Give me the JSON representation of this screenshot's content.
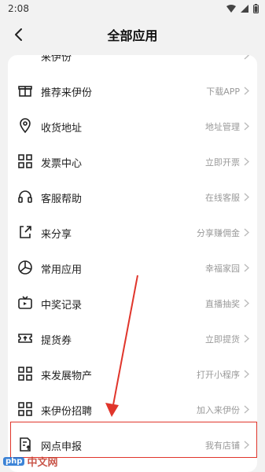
{
  "status": {
    "time": "2:08"
  },
  "header": {
    "title": "全部应用"
  },
  "items": [
    {
      "label": "来伊份",
      "value": "",
      "icon": "partial-icon"
    },
    {
      "label": "推荐来伊份",
      "value": "下载APP",
      "icon": "gift-icon"
    },
    {
      "label": "收货地址",
      "value": "地址管理",
      "icon": "location-pin-icon"
    },
    {
      "label": "发票中心",
      "value": "立即开票",
      "icon": "grid-icon"
    },
    {
      "label": "客服帮助",
      "value": "在线客服",
      "icon": "headset-icon"
    },
    {
      "label": "来分享",
      "value": "分享赚佣金",
      "icon": "share-icon"
    },
    {
      "label": "常用应用",
      "value": "幸福家园",
      "icon": "aperture-icon"
    },
    {
      "label": "中奖记录",
      "value": "直播抽奖",
      "icon": "tv-icon"
    },
    {
      "label": "提货券",
      "value": "立即提货",
      "icon": "ticket-icon"
    },
    {
      "label": "来发展物产",
      "value": "打开小程序",
      "icon": "grid-icon"
    },
    {
      "label": "来伊份招聘",
      "value": "加入来伊份",
      "icon": "grid-icon"
    },
    {
      "label": "网点申报",
      "value": "我有店铺",
      "icon": "document-upload-icon"
    }
  ],
  "watermark": {
    "badge": "php",
    "text": "中文网"
  },
  "colors": {
    "highlight": "#e0352b"
  }
}
